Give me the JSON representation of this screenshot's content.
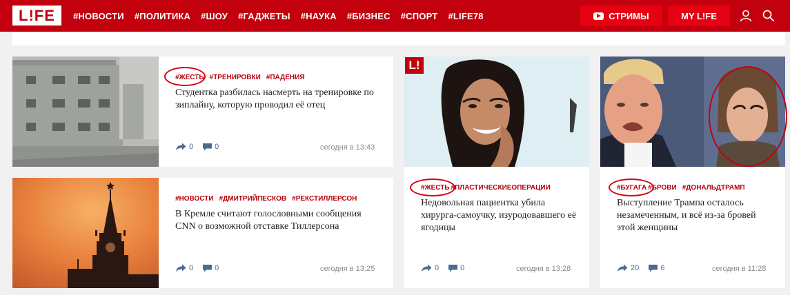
{
  "header": {
    "logo": "L!FE",
    "nav": [
      "#НОВОСТИ",
      "#ПОЛИТИКА",
      "#ШОУ",
      "#ГАДЖЕТЫ",
      "#НАУКА",
      "#БИЗНЕС",
      "#СПОРТ",
      "#LIFE78"
    ],
    "streams_label": "СТРИМЫ",
    "mylife_label": "MY L!FE"
  },
  "cards": [
    {
      "tags": [
        "#ЖЕСТЬ",
        "#ТРЕНИРОВКИ",
        "#ПАДЕНИЯ"
      ],
      "title": "Студентка разбилась насмерть на тренировке по зиплайну, которую проводил её отец",
      "shares": "0",
      "comments": "0",
      "time": "сегодня в 13:43"
    },
    {
      "tags": [
        "#НОВОСТИ",
        "#ДМИТРИЙПЕСКОВ",
        "#РЕКСТИЛЛЕРСОН"
      ],
      "title": "В Кремле считают голословными сообщения CNN о возможной отставке Тиллерсона",
      "shares": "0",
      "comments": "0",
      "time": "сегодня в 13:25"
    },
    {
      "badge": "L!",
      "tags": [
        "#ЖЕСТЬ",
        "#ПЛАСТИЧЕСКИЕОПЕРАЦИИ"
      ],
      "title": "Недовольная пациентка убила хирурга-самоучку, изуродовавшего её ягодицы",
      "shares": "0",
      "comments": "0",
      "time": "сегодня в 13:28"
    },
    {
      "tags": [
        "#БУГАГА",
        "#БРОВИ",
        "#ДОНАЛЬДТРАМП"
      ],
      "title": "Выступление Трампа осталось незамеченным, и всё из-за бровей этой женщины",
      "shares": "20",
      "comments": "6",
      "time": "сегодня в 11:28"
    }
  ],
  "colors": {
    "brand": "#c3000e",
    "button": "#e50012",
    "tag": "#b5000c"
  }
}
